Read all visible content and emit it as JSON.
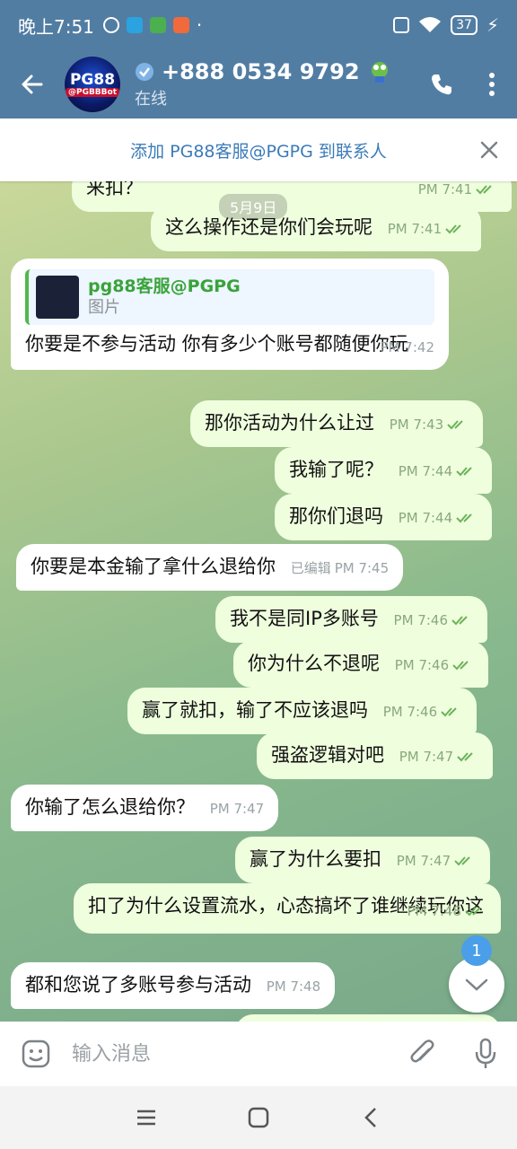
{
  "status_bar": {
    "time": "晚上7:51",
    "battery": "37"
  },
  "header": {
    "avatar_text_top": "PG88",
    "avatar_text_bottom": "@PGBBBot",
    "title": "+888 0534 9792",
    "status": "在线"
  },
  "add_contact": {
    "text": "添加 PG88客服@PGPG 到联系人"
  },
  "chat": {
    "date": "5月9日",
    "messages": [
      {
        "dir": "out",
        "text": "来扣？",
        "time": "PM 7:41"
      },
      {
        "dir": "out",
        "text": "这么操作还是你们会玩呢",
        "time": "PM 7:41"
      },
      {
        "dir": "in",
        "reply_title": "pg88客服@PGPG",
        "reply_sub": "图片",
        "text": "你要是不参与活动 你有多少个账号都随便你玩",
        "time": "PM 7:42"
      },
      {
        "dir": "out",
        "text": "那你活动为什么让过",
        "time": "PM 7:43"
      },
      {
        "dir": "out",
        "text": "我输了呢？",
        "time": "PM 7:44"
      },
      {
        "dir": "out",
        "text": "那你们退吗",
        "time": "PM 7:44"
      },
      {
        "dir": "in",
        "text": "你要是本金输了拿什么退给你",
        "edited": "已编辑",
        "time": "PM 7:45"
      },
      {
        "dir": "out",
        "text": "我不是同IP多账号",
        "time": "PM 7:46"
      },
      {
        "dir": "out",
        "text": "你为什么不退呢",
        "time": "PM 7:46"
      },
      {
        "dir": "out",
        "text": "赢了就扣，输了不应该退吗",
        "time": "PM 7:46"
      },
      {
        "dir": "out",
        "text": "强盗逻辑对吧",
        "time": "PM 7:47"
      },
      {
        "dir": "in",
        "text": "你输了怎么退给你？",
        "time": "PM 7:47"
      },
      {
        "dir": "out",
        "text": "赢了为什么要扣",
        "time": "PM 7:47"
      },
      {
        "dir": "out",
        "text": "扣了为什么设置流水，心态搞坏了谁继续玩你这",
        "time": "PM 7:48"
      },
      {
        "dir": "in",
        "text": "都和您说了多账号参与活动",
        "time": "PM 7:48"
      }
    ],
    "unread_count": "1"
  },
  "input": {
    "placeholder": "输入消息"
  },
  "colors": {
    "header": "#527da3",
    "outgoing": "#efffde",
    "accent": "#3b7bb8"
  }
}
